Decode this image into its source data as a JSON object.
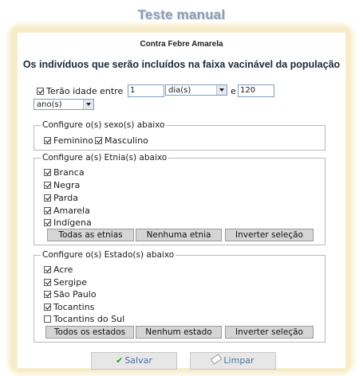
{
  "page": {
    "title": "Teste manual",
    "subtitle": "Contra Febre Amarela",
    "heading": "Os indivíduos que serão incluídos na faixa vacinável da população"
  },
  "age": {
    "checked": true,
    "label": "Terão idade entre",
    "from_value": "1",
    "from_unit": "dia(s)",
    "and_label": "e",
    "to_value": "120",
    "to_unit": "ano(s)"
  },
  "sex": {
    "legend": "Configure o(s) sexo(s) abaixo",
    "items": [
      {
        "label": "Feminino",
        "checked": true
      },
      {
        "label": "Masculino",
        "checked": true
      }
    ]
  },
  "ethnicity": {
    "legend": "Configure a(s) Etnia(s) abaixo",
    "items": [
      {
        "label": "Branca",
        "checked": true
      },
      {
        "label": "Negra",
        "checked": true
      },
      {
        "label": "Parda",
        "checked": true
      },
      {
        "label": "Amarela",
        "checked": true
      },
      {
        "label": "Indígena",
        "checked": true
      }
    ],
    "buttons": {
      "all": "Todas as etnias",
      "none": "Nenhuma etnia",
      "invert": "Inverter seleção"
    }
  },
  "state": {
    "legend": "Configure o(s) Estado(s) abaixo",
    "items": [
      {
        "label": "Acre",
        "checked": true
      },
      {
        "label": "Sergipe",
        "checked": true
      },
      {
        "label": "São Paulo",
        "checked": true
      },
      {
        "label": "Tocantins",
        "checked": true
      },
      {
        "label": "Tocantins do Sul",
        "checked": false
      }
    ],
    "buttons": {
      "all": "Todos os estados",
      "none": "Nenhum estado",
      "invert": "Inverter seleção"
    }
  },
  "actions": {
    "save": "Salvar",
    "clear": "Limpar"
  }
}
